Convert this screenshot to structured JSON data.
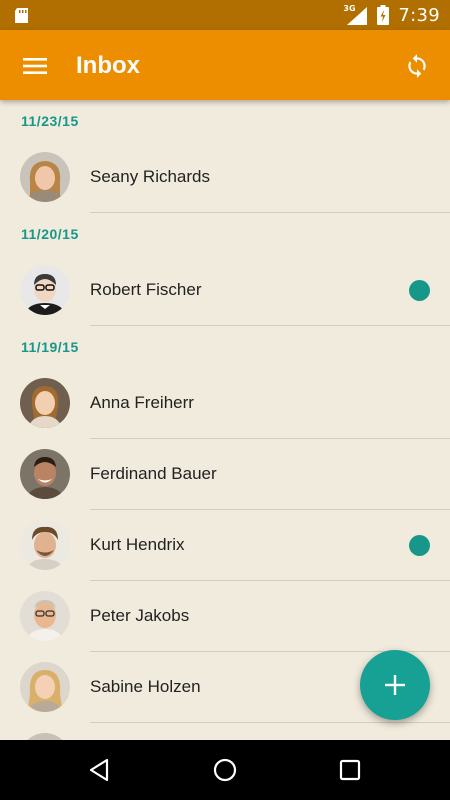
{
  "status_bar": {
    "network_type": "3G",
    "time": "7:39",
    "icons": [
      "sd-card-icon",
      "signal-icon",
      "battery-charging-icon"
    ]
  },
  "app_bar": {
    "title": "Inbox",
    "menu_icon": "hamburger-menu-icon",
    "refresh_icon": "sync-icon",
    "color": "#ed8e00"
  },
  "groups": [
    {
      "date": "11/23/15",
      "items": [
        {
          "name": "Seany Richards",
          "unread": false,
          "avatar": "female-photo"
        }
      ]
    },
    {
      "date": "11/20/15",
      "items": [
        {
          "name": "Robert Fischer",
          "unread": true,
          "avatar": "male-photo"
        }
      ]
    },
    {
      "date": "11/19/15",
      "items": [
        {
          "name": "Anna Freiherr",
          "unread": false,
          "avatar": "female-photo"
        },
        {
          "name": "Ferdinand Bauer",
          "unread": false,
          "avatar": "male-photo"
        },
        {
          "name": "Kurt Hendrix",
          "unread": true,
          "avatar": "male-photo"
        },
        {
          "name": "Peter Jakobs",
          "unread": false,
          "avatar": "male-photo"
        },
        {
          "name": "Sabine Holzen",
          "unread": false,
          "avatar": "female-photo"
        }
      ]
    }
  ],
  "fab": {
    "icon": "plus-icon",
    "color": "#17a094"
  },
  "nav_bar": {
    "icons": [
      "back-icon",
      "home-icon",
      "recents-icon"
    ]
  },
  "colors": {
    "accent": "#16978a",
    "background": "#f1ebdd",
    "status_bar": "#b06f00"
  }
}
